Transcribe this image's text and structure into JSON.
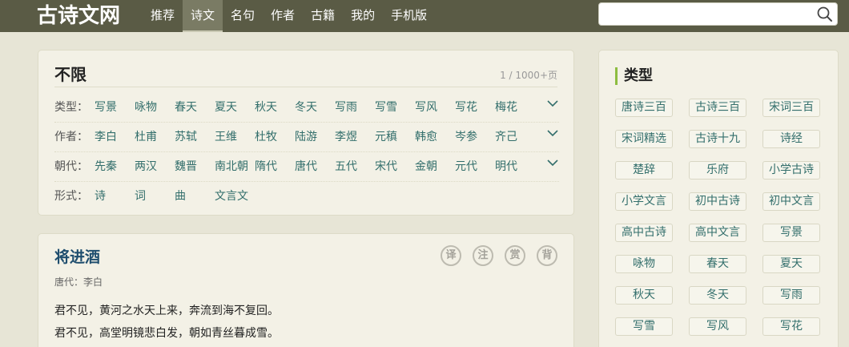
{
  "header": {
    "logo": "古诗文网",
    "nav": [
      "推荐",
      "诗文",
      "名句",
      "作者",
      "古籍",
      "我的",
      "手机版"
    ],
    "active_nav": 1,
    "search": {
      "value": "",
      "placeholder": ""
    }
  },
  "filter": {
    "title": "不限",
    "count": "1 / 1000+页",
    "rows": [
      {
        "label": "类型：",
        "options": [
          "写景",
          "咏物",
          "春天",
          "夏天",
          "秋天",
          "冬天",
          "写雨",
          "写雪",
          "写风",
          "写花",
          "梅花"
        ]
      },
      {
        "label": "作者：",
        "options": [
          "李白",
          "杜甫",
          "苏轼",
          "王维",
          "杜牧",
          "陆游",
          "李煜",
          "元稹",
          "韩愈",
          "岑参",
          "齐己"
        ]
      },
      {
        "label": "朝代：",
        "options": [
          "先秦",
          "两汉",
          "魏晋",
          "南北朝",
          "隋代",
          "唐代",
          "五代",
          "宋代",
          "金朝",
          "元代",
          "明代"
        ]
      },
      {
        "label": "形式：",
        "options": [
          "诗",
          "词",
          "曲",
          "文言文"
        ]
      }
    ]
  },
  "poem": {
    "title": "将进酒",
    "meta": "唐代：李白",
    "tools": [
      "译",
      "注",
      "赏",
      "背"
    ],
    "lines": [
      "君不见，黄河之水天上来，奔流到海不复回。",
      "君不见，高堂明镜悲白发，朝如青丝暮成雪。"
    ]
  },
  "types": {
    "title": "类型",
    "tags": [
      "唐诗三百",
      "古诗三百",
      "宋词三百",
      "宋词精选",
      "古诗十九",
      "诗经",
      "楚辞",
      "乐府",
      "小学古诗",
      "小学文言",
      "初中古诗",
      "初中文言",
      "高中古诗",
      "高中文言",
      "写景",
      "咏物",
      "春天",
      "夏天",
      "秋天",
      "冬天",
      "写雨",
      "写雪",
      "写风",
      "写花"
    ]
  },
  "colors": {
    "topbar": "#5a5b45",
    "background": "#e7e5d6",
    "card": "#f3f1e6",
    "link": "#326e6b",
    "accent": "#8dbd40"
  }
}
